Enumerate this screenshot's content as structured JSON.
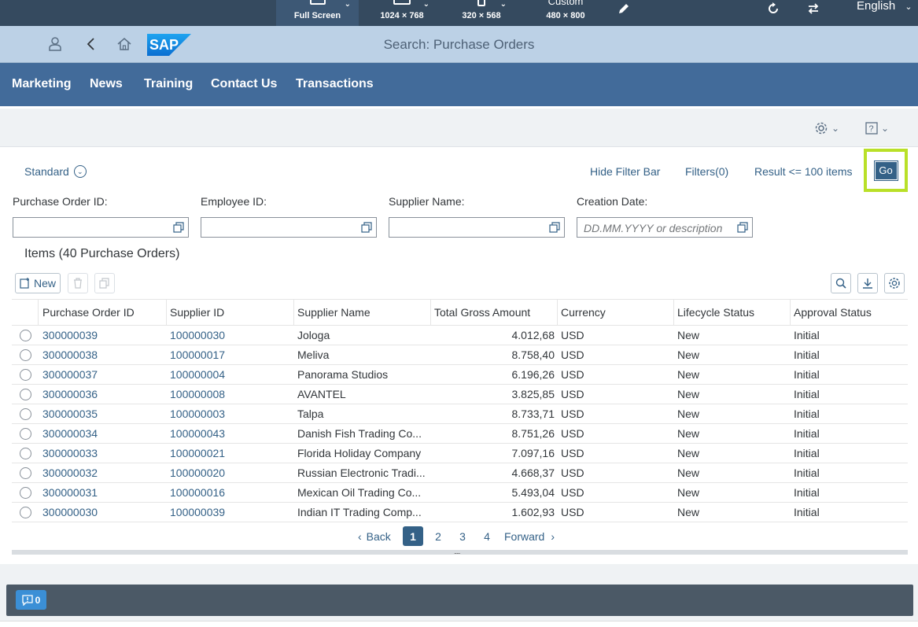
{
  "simulator": {
    "devices": [
      {
        "label": "Full Screen",
        "active": true
      },
      {
        "label": "1024 × 768",
        "active": false
      },
      {
        "label": "320 × 568",
        "active": false
      },
      {
        "label_top": "Custom",
        "label": "480 × 800",
        "active": false
      }
    ],
    "language": "English"
  },
  "shell": {
    "title": "Search: Purchase Orders",
    "logo_text": "SAP"
  },
  "nav": {
    "items": [
      "Marketing",
      "News",
      "Training",
      "Contact Us",
      "Transactions"
    ]
  },
  "filterbar": {
    "variant": "Standard",
    "hide_filter_bar": "Hide Filter Bar",
    "filters": "Filters(0)",
    "result_limit": "Result <= 100 items",
    "go": "Go",
    "fields": [
      {
        "label": "Purchase Order ID:",
        "value": "",
        "placeholder": ""
      },
      {
        "label": "Employee ID:",
        "value": "",
        "placeholder": ""
      },
      {
        "label": "Supplier Name:",
        "value": "",
        "placeholder": ""
      },
      {
        "label": "Creation Date:",
        "value": "",
        "placeholder": "DD.MM.YYYY or description"
      }
    ]
  },
  "table": {
    "title": "Items (40 Purchase Orders)",
    "new_label": "New",
    "columns": [
      "Purchase Order ID",
      "Supplier ID",
      "Supplier Name",
      "Total Gross Amount",
      "Currency",
      "Lifecycle Status",
      "Approval Status"
    ],
    "rows": [
      {
        "po": "300000039",
        "sup": "100000030",
        "name": "Jologa",
        "amount": "4.012,68",
        "cur": "USD",
        "life": "New",
        "appr": "Initial"
      },
      {
        "po": "300000038",
        "sup": "100000017",
        "name": "Meliva",
        "amount": "8.758,40",
        "cur": "USD",
        "life": "New",
        "appr": "Initial"
      },
      {
        "po": "300000037",
        "sup": "100000004",
        "name": "Panorama Studios",
        "amount": "6.196,26",
        "cur": "USD",
        "life": "New",
        "appr": "Initial"
      },
      {
        "po": "300000036",
        "sup": "100000008",
        "name": "AVANTEL",
        "amount": "3.825,85",
        "cur": "USD",
        "life": "New",
        "appr": "Initial"
      },
      {
        "po": "300000035",
        "sup": "100000003",
        "name": "Talpa",
        "amount": "8.733,71",
        "cur": "USD",
        "life": "New",
        "appr": "Initial"
      },
      {
        "po": "300000034",
        "sup": "100000043",
        "name": "Danish Fish Trading Co...",
        "amount": "8.751,26",
        "cur": "USD",
        "life": "New",
        "appr": "Initial"
      },
      {
        "po": "300000033",
        "sup": "100000021",
        "name": "Florida Holiday Company",
        "amount": "7.097,16",
        "cur": "USD",
        "life": "New",
        "appr": "Initial"
      },
      {
        "po": "300000032",
        "sup": "100000020",
        "name": "Russian Electronic Tradi...",
        "amount": "4.668,37",
        "cur": "USD",
        "life": "New",
        "appr": "Initial"
      },
      {
        "po": "300000031",
        "sup": "100000016",
        "name": "Mexican Oil Trading Co...",
        "amount": "5.493,04",
        "cur": "USD",
        "life": "New",
        "appr": "Initial"
      },
      {
        "po": "300000030",
        "sup": "100000039",
        "name": "Indian IT Trading Comp...",
        "amount": "1.602,93",
        "cur": "USD",
        "life": "New",
        "appr": "Initial"
      }
    ]
  },
  "pager": {
    "back": "Back",
    "forward": "Forward",
    "pages": [
      "1",
      "2",
      "3",
      "4"
    ],
    "current": "1"
  },
  "footer": {
    "message_count": "0"
  },
  "colors": {
    "shell_bg": "#bcd1e6",
    "nav_bg": "#426b9a",
    "link": "#346187",
    "highlight": "#b9e028"
  }
}
